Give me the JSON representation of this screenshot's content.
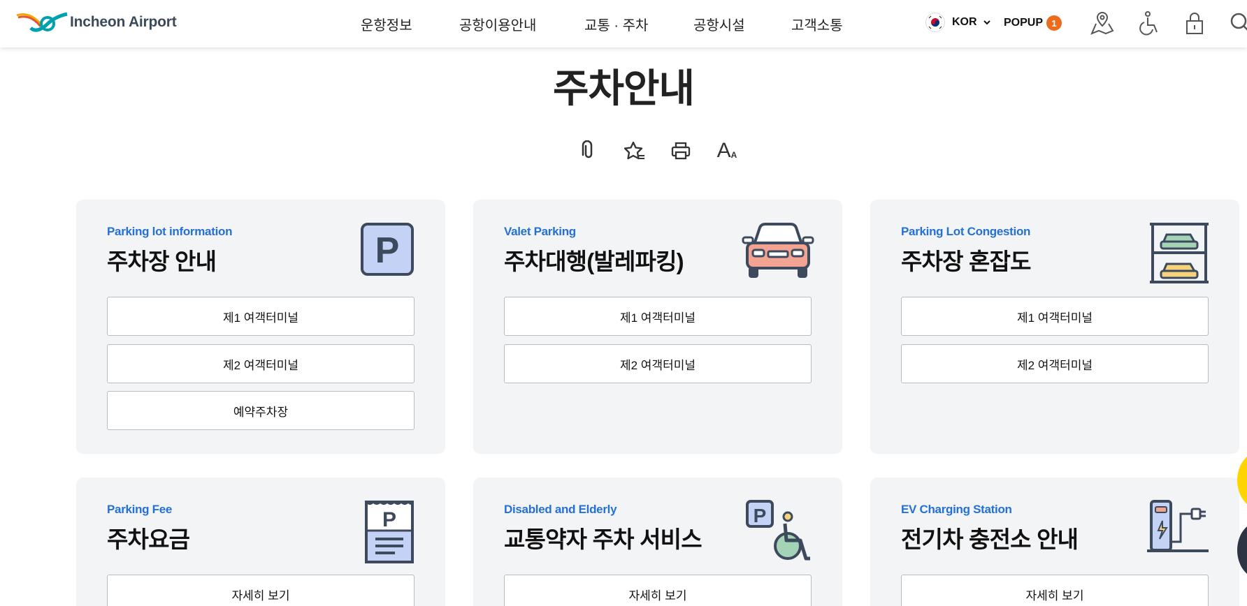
{
  "header": {
    "logo_text": "Incheon Airport",
    "nav": [
      "운항정보",
      "공항이용안내",
      "교통 · 주차",
      "공항시설",
      "고객소통"
    ],
    "lang": "KOR",
    "popup_label": "POPUP",
    "popup_count": "1",
    "icons": [
      "map-pin-icon",
      "accessibility-icon",
      "lock-icon",
      "search-icon"
    ]
  },
  "page": {
    "title": "주차안내",
    "tools": [
      "link-icon",
      "star-icon",
      "print-icon",
      "font-size-icon"
    ],
    "font_tool_large": "A",
    "font_tool_small": "A"
  },
  "colors": {
    "accent_blue": "#2470d4",
    "badge_orange": "#ef6b1c",
    "card_bg": "#f3f4f6",
    "yellow": "#ffd400"
  },
  "cards": [
    {
      "sub": "Parking lot information",
      "title": "주차장 안내",
      "icon": "parking-sign-icon",
      "buttons": [
        "제1 여객터미널",
        "제2 여객터미널",
        "예약주차장"
      ]
    },
    {
      "sub": "Valet Parking",
      "title": "주차대행(발레파킹)",
      "icon": "car-icon",
      "buttons": [
        "제1 여객터미널",
        "제2 여객터미널"
      ]
    },
    {
      "sub": "Parking Lot Congestion",
      "title": "주차장 혼잡도",
      "icon": "parking-garage-icon",
      "buttons": [
        "제1 여객터미널",
        "제2 여객터미널"
      ]
    },
    {
      "sub": "Parking Fee",
      "title": "주차요금",
      "icon": "parking-ticket-icon",
      "buttons": [
        "자세히 보기"
      ]
    },
    {
      "sub": "Disabled and Elderly",
      "title": "교통약자 주차 서비스",
      "icon": "disabled-parking-icon",
      "buttons": [
        "자세히 보기"
      ]
    },
    {
      "sub": "EV Charging Station",
      "title": "전기차 충전소 안내",
      "icon": "ev-charger-icon",
      "buttons": [
        "자세히 보기"
      ]
    }
  ]
}
